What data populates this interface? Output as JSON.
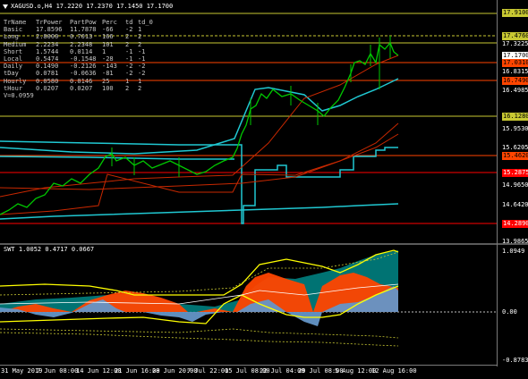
{
  "main_chart": {
    "title": "XAGUSD.o,H4  17.2220 17.2370 17.1450 17.1700",
    "table_header": [
      "TrName",
      "TrPower",
      "PartPow",
      "Perc",
      "td",
      "td_0"
    ],
    "table_rows": [
      [
        "Basic",
        "17.8596",
        "11.7878",
        "-66",
        "-2",
        "1"
      ],
      [
        "Long",
        "2.8000",
        "0.7013",
        "166",
        "2",
        "2"
      ],
      [
        "Medium",
        "2.2234",
        "2.2348",
        "101",
        "2",
        "2"
      ],
      [
        "Short",
        "1.5744",
        "0.0114",
        "1",
        "-1",
        "-1"
      ],
      [
        "Local",
        "0.5474",
        "-0.1548",
        "-28",
        "-1",
        "-1"
      ],
      [
        "Daily",
        "0.1490",
        "-0.2126",
        "-143",
        "-2",
        "-2"
      ],
      [
        "tDay",
        "0.0781",
        "-0.0636",
        "-81",
        "-2",
        "-2"
      ],
      [
        "Hourly",
        "0.0580",
        "0.0146",
        "25",
        "1",
        "1"
      ],
      [
        "tHour",
        "0.0207",
        "0.0207",
        "100",
        "2",
        "2"
      ]
    ],
    "v_label": "V=0.0959",
    "price_scale": [
      "17.9100",
      "17.4760",
      "17.3225",
      "17.1700",
      "17.0310",
      "16.8315",
      "16.7490",
      "16.4985",
      "16.1280",
      "15.9530",
      "15.6205",
      "15.4620",
      "15.2875",
      "14.9650",
      "14.6420",
      "14.2890",
      "13.9865"
    ],
    "highlighted_prices": [
      {
        "value": "17.9100",
        "bg": "#c8c832",
        "fg": "#000000"
      },
      {
        "value": "17.4760",
        "bg": "#c8c832",
        "fg": "#000000"
      },
      {
        "value": "17.1700",
        "bg": "#ffffff",
        "fg": "#000000"
      },
      {
        "value": "17.0310",
        "bg": "#ff4500",
        "fg": "#000000"
      },
      {
        "value": "16.7490",
        "bg": "#ff4500",
        "fg": "#000000"
      },
      {
        "value": "16.1280",
        "bg": "#c8c832",
        "fg": "#000000"
      },
      {
        "value": "15.4620",
        "bg": "#ff4500",
        "fg": "#000000"
      },
      {
        "value": "15.2875",
        "bg": "#ff0000",
        "fg": "#ffffff"
      },
      {
        "value": "14.2890",
        "bg": "#ff0000",
        "fg": "#ffffff"
      }
    ]
  },
  "sub_chart": {
    "title": "SWT 1.0052 0.4717 0.0667",
    "scale": [
      "1.0949",
      "0.00",
      "-0.8783"
    ]
  },
  "x_axis": [
    "31 May 2019",
    "7 Jun 08:00",
    "14 Jun 12:00",
    "21 Jun 16:00",
    "28 Jun 20:00",
    "7 Jul 22:00",
    "15 Jul 08:00",
    "22 Jul 04:00",
    "29 Jul 08:00",
    "5 Aug 12:00",
    "12 Aug 16:00"
  ],
  "colors": {
    "candles": "#00c800",
    "ma_cyan": "#20c8d2",
    "ma_red": "#c82800",
    "level_yellow": "#c8c832",
    "level_red": "#ff0000",
    "hist_orange": "#ff4500",
    "hist_teal": "#008080",
    "hist_blue": "#6496c8",
    "line_yellow": "#ffff00"
  }
}
